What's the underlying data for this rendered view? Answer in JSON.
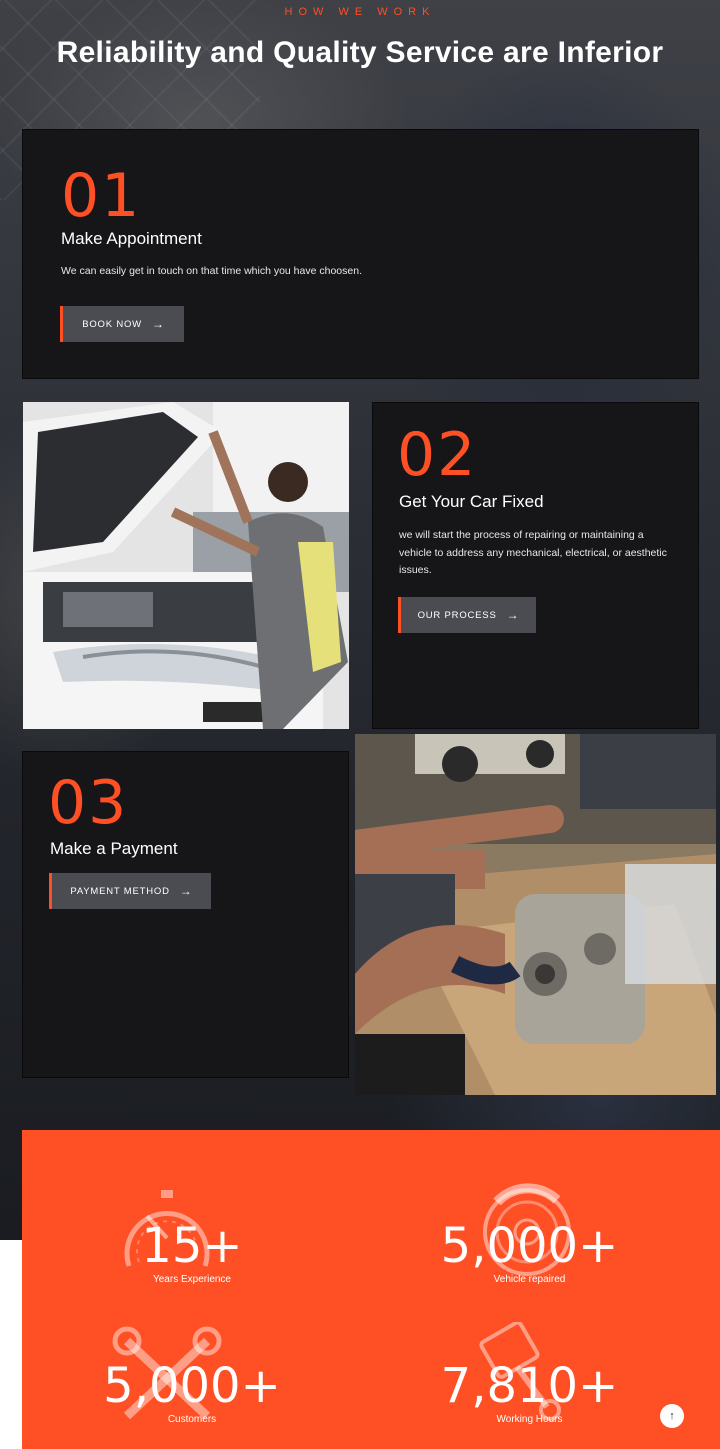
{
  "header": {
    "overline": "HOW WE WORK",
    "title": "Reliability and Quality Service are Inferior"
  },
  "steps": [
    {
      "number": "01",
      "title": "Make Appointment",
      "text": "We can easily get in touch  on  that time which you have choosen.",
      "button": "BOOK NOW"
    },
    {
      "number": "02",
      "title": "Get Your Car Fixed",
      "text": "we will start the process of repairing or maintaining a vehicle to address any mechanical, electrical, or aesthetic issues.",
      "button": "OUR PROCESS"
    },
    {
      "number": "03",
      "title": "Make a Payment",
      "button": "PAYMENT METHOD"
    }
  ],
  "stats": [
    {
      "value": "15+",
      "label": "Years Experience",
      "icon": "speedometer-icon"
    },
    {
      "value": "5,000+",
      "label": "Vehicle repaired",
      "icon": "brake-disc-icon"
    },
    {
      "value": "5,000+",
      "label": "Customers",
      "icon": "crossed-wrenches-icon"
    },
    {
      "value": "7,810+",
      "label": "Working Hours",
      "icon": "piston-icon"
    }
  ],
  "colors": {
    "accent": "#ff4f24",
    "card": "#161618",
    "button": "#4a4c52"
  },
  "scroll_top_icon": "arrow-up-icon",
  "scroll_top_glyph": "↑",
  "arrow_glyph": "→"
}
